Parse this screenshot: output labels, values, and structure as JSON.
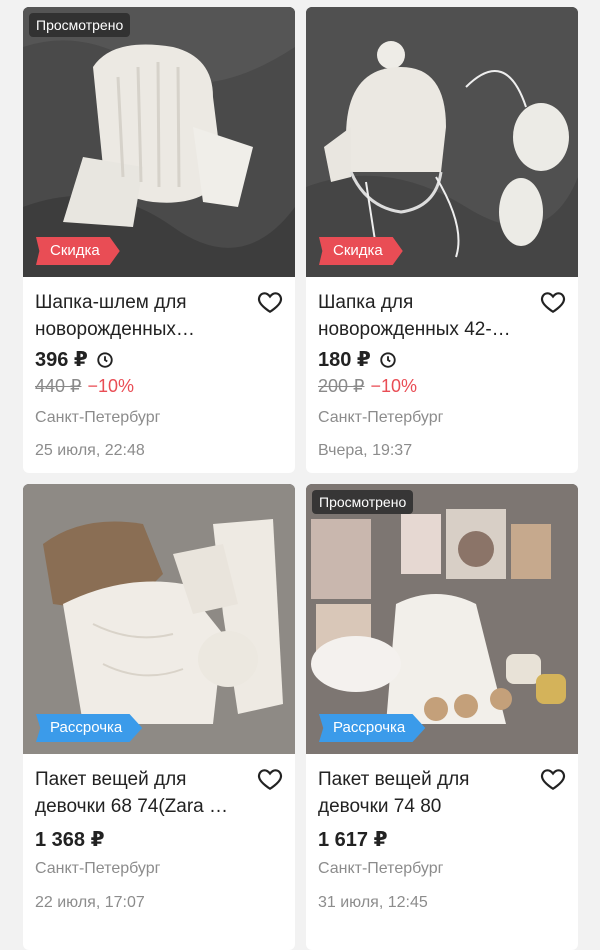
{
  "listings": [
    {
      "viewed": "Просмотрено",
      "tag": "Скидка",
      "title_line1": "Шапка-шлем для",
      "title_line2": "новорожденных…",
      "price": "396 ₽",
      "old_price": "440 ₽",
      "discount": "−10%",
      "city": "Санкт-Петербург",
      "date": "25 июля, 22:48"
    },
    {
      "tag": "Скидка",
      "title_line1": "Шапка для",
      "title_line2": "новорожденных 42-…",
      "price": "180 ₽",
      "old_price": "200 ₽",
      "discount": "−10%",
      "city": "Санкт-Петербург",
      "date": "Вчера, 19:37"
    },
    {
      "tag": "Рассрочка",
      "title_line1": "Пакет вещей для",
      "title_line2": "девочки 68 74(Zara …",
      "price": "1 368 ₽",
      "city": "Санкт-Петербург",
      "date": "22 июля, 17:07"
    },
    {
      "viewed": "Просмотрено",
      "tag": "Рассрочка",
      "title_line1": "Пакет вещей для",
      "title_line2": "девочки 74 80",
      "price": "1 617 ₽",
      "city": "Санкт-Петербург",
      "date": "31 июля, 12:45"
    }
  ],
  "icons": {
    "favorite": "heart-outline-icon",
    "delivery_time": "clock-icon"
  },
  "colors": {
    "discount": "#e94d55",
    "installment": "#3b9bea",
    "muted_text": "#8c8c8c"
  }
}
